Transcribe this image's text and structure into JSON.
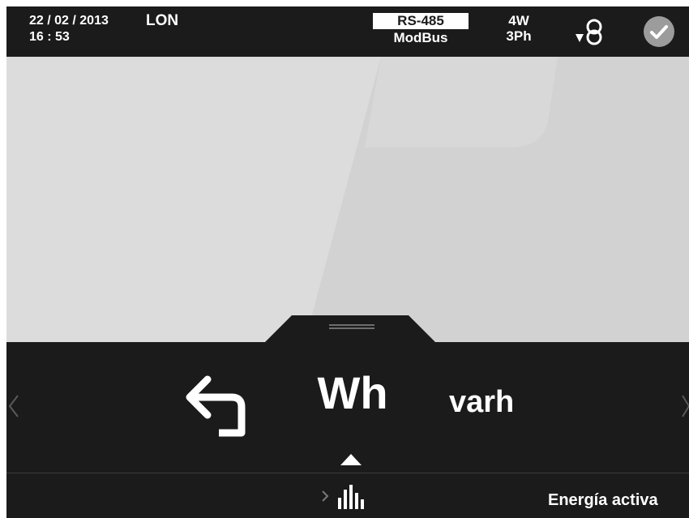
{
  "header": {
    "date": "22 / 02 / 2013",
    "time": "16 : 53",
    "mode": "LON",
    "comm_protocol_top": "RS-485",
    "comm_protocol_bottom": "ModBus",
    "wires": "4W",
    "phases": "3Ph"
  },
  "icons": {
    "transformer": "transformer-icon",
    "status": "check-circle-icon",
    "back": "back-arrow-icon",
    "bars": "bar-chart-icon"
  },
  "selector": {
    "selected": "Wh",
    "next": "varh"
  },
  "footer": {
    "title": "Energía activa"
  },
  "colors": {
    "background": "#1b1b1b",
    "content": "#d7d7d7",
    "status": "#9c9c9c",
    "text": "#ffffff"
  }
}
